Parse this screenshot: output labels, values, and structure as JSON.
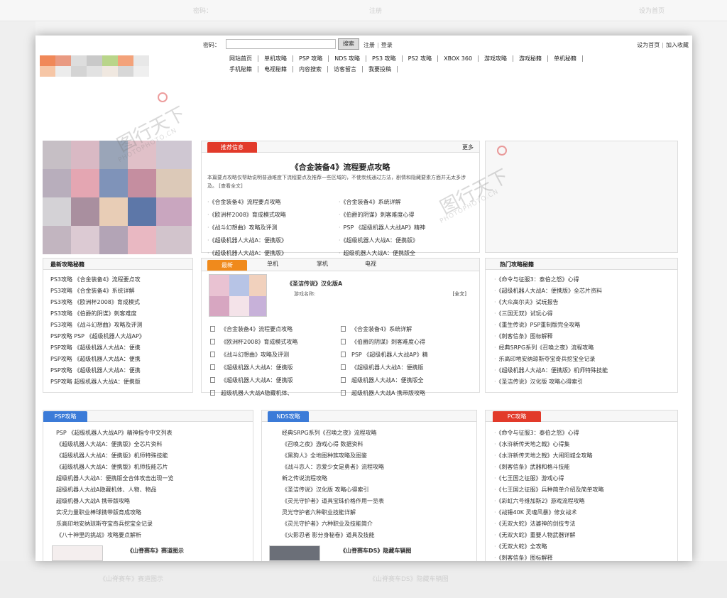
{
  "header": {
    "password_label": "密码：",
    "search_button": "搜索",
    "register_link": "注册",
    "login_link": "登录",
    "set_home": "设为首页",
    "add_favorite": "加入收藏"
  },
  "nav": {
    "row1": [
      "网站首页",
      "单机攻略",
      "PSP 攻略",
      "NDS 攻略",
      "PS3 攻略",
      "PS2 攻略",
      "XBOX 360",
      "游戏攻略",
      "游戏秘籍",
      "单机秘籍"
    ],
    "row2": [
      "手机秘籍",
      "电视秘籍",
      "内容搜索",
      "访客留言",
      "我要投稿"
    ]
  },
  "feature": {
    "tab": "推荐信息",
    "more": "更多",
    "title": "《合金装备4》流程要点攻略",
    "desc": "本篇要点攻略仅帮助说明普通难度下流程要点及推荐一些区域的，不使炭线通过方法，剧情和隐藏要素方面并无太多涉及。 [查看全文]",
    "items": [
      "《合金装备4》流程要点攻略",
      "《合金装备4》系统详解",
      "《欧洲杯2008》育成模式攻略",
      "《伯爵的阴谋》刺客难度心得",
      "《战斗幻想曲》攻略及评测",
      "PSP 《超级机器人大战AP》精神",
      "《超级机器人大战A：便携版》",
      "《超级机器人大战A：便携版》",
      "《超级机器人大战A：便携版》",
      "超级机器人大战A：便携版全"
    ]
  },
  "latest": {
    "title": "最新攻略秘籍",
    "items": [
      "PS3攻略 《合金装备4》流程要点攻",
      "PS3攻略 《合金装备4》系统详解",
      "PS3攻略 《欧洲杯2008》育成模式",
      "PS3攻略 《伯爵的阴谋》刺客难度",
      "PS3攻略 《战斗幻想曲》攻略及评测",
      "PSP攻略 PSP 《超级机器人大战AP》",
      "PSP攻略 《超级机器人大战A：便携",
      "PSP攻略 《超级机器人大战A：便携",
      "PSP攻略 《超级机器人大战A：便携",
      "PSP攻略 超级机器人大战A：便携版"
    ]
  },
  "middle": {
    "tabs": [
      "最新",
      "单机",
      "掌机",
      "电视"
    ],
    "game_title": "《圣洁传说》汉化版A",
    "game_name_label": "游戏名称:",
    "full_text": "[全文]",
    "items": [
      "《合金装备4》流程要点攻略",
      "《合金装备4》系统详解",
      "《欧洲杯2008》育成模式攻略",
      "《伯爵的阴谋》刺客难度心得",
      "《战斗幻想曲》攻略及评测",
      "PSP 《超级机器人大战AP》精",
      "《超级机器人大战A：便携版",
      "《超级机器人大战A：便携版",
      "《超级机器人大战A：便携版",
      "超级机器人大战A：便携版全",
      "超级机器人大战A隐藏机体、",
      "超级机器人大战A 携带版攻略"
    ]
  },
  "hot": {
    "title": "热门攻略秘籍",
    "items": [
      "《命令与征服3：泰伯之怒》心得",
      "《超级机器人大战A：便携版》全芯片资料",
      "《大众高尔夫》试玩报告",
      "《三国无双》试玩心得",
      "《重生传说》PSP重制版完全攻略",
      "《刺客信条》图标解释",
      "经典SRPG系列《召唤之夜》流程攻略",
      "乐高印地安纳琼斯夺宝奇兵挖宝全记录",
      "《超级机器人大战A：便携版》机师特殊技能",
      "《圣洁传说》汉化版 攻略心得索引"
    ]
  },
  "psp": {
    "tab": "PSP攻略",
    "items": [
      "PSP 《超级机器人大战AP》精神指令中文列表",
      "《超级机器人大战A：便携版》全芯片资料",
      "《超级机器人大战A：便携版》机师特殊技能",
      "《超级机器人大战A：便携版》机师技能芯片",
      "超级机器人大战A：便携版全合体攻击出现一览",
      "超级机器人大战A隐藏机体、人物、物品",
      "超级机器人大战A 携带版攻略",
      "实况力量职业棒球携带版育成攻略",
      "乐高印地安纳琼斯夺宝奇兵挖宝全记录",
      "《八十神里的挑战》攻略要点解析"
    ],
    "thumb_title": "《山脊赛车》赛道图示"
  },
  "nds": {
    "tab": "NDS攻略",
    "items": [
      "经典SRPG系列《召唤之夜》流程攻略",
      "《召唤之夜》游戏心得 数据资料",
      "《黑狗人》全地图种族攻略及图鉴",
      "《战斗恋人：恋爱少女是勇者》流程攻略",
      "新之传说流程攻略",
      "《圣洁传说》汉化版 攻略心得索引",
      "《灵光守护者》道具宝珠价格作用一览表",
      "灵光守护者六种职业技能详解",
      "《灵光守护者》六种职业及技能简介",
      "《火影忍者 影分身秘卷》道具及技能"
    ],
    "thumb_title": "《山脊赛车DS》隐藏车辆图"
  },
  "pc": {
    "tab": "PC攻略",
    "items": [
      "《命令与征服3：泰伯之怒》心得",
      "《水浒新传天地之戟》心得集",
      "《水浒新传天地之戟》大闹阳城全攻略",
      "《刺客信条》武器和格斗技能",
      "《七王国之征服》游戏心得",
      "《七王国之征服》兵种简单介绍及简单攻略",
      "《彩虹六号维加斯2》游戏流程攻略",
      "《战锤40K 灵魂风暴》修女战术",
      "《无双大蛇》法婆神的剑技专法",
      "《无双大蛇》重要人物武器详解",
      "《无双大蛇》全攻略",
      "《刺客信条》图标解释"
    ]
  },
  "watermark": {
    "text": "图行天下",
    "sub": "PHOTOPHOTO.CN"
  },
  "colors": {
    "tab_red": "#e23a2a",
    "tab_blue": "#3b7bd8",
    "tab_orange": "#f08a1c"
  }
}
